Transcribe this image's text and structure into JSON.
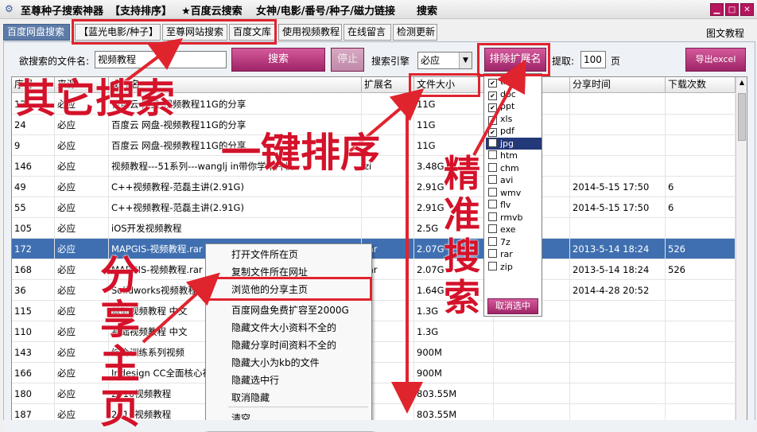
{
  "window": {
    "title_app": "至尊种子搜索神器",
    "title_menu": [
      "【支持排序】",
      "★百度云搜索",
      "女神/电影/番号/种子/磁力链接",
      "搜索"
    ]
  },
  "tabs": [
    "百度网盘搜索",
    "【蓝光电影/种子】",
    "至尊网站搜索",
    "百度文库",
    "使用视频教程",
    "在线留言",
    "检测更新"
  ],
  "help_link": "图文教程",
  "search": {
    "filename_label": "欲搜索的文件名:",
    "filename_value": "视频教程",
    "search_button": "搜索",
    "stop_button": "停止",
    "engine_label": "搜索引擎",
    "engine_value": "必应",
    "exclude_button": "排除扩展名",
    "fetch_label": "提取:",
    "fetch_value": "100",
    "page_unit": "页",
    "export_button": "导出excel"
  },
  "table": {
    "columns": [
      "序号",
      "来源",
      "文件名",
      "扩展名",
      "文件大小",
      "分享时间",
      "下载次数"
    ],
    "rows": [
      {
        "id": "17",
        "src": "必应",
        "name": "百度云 网盘-视频教程11G的分享",
        "ext": "",
        "size": "11G",
        "time": "",
        "dl": ""
      },
      {
        "id": "24",
        "src": "必应",
        "name": "百度云 网盘-视频教程11G的分享",
        "ext": "",
        "size": "11G",
        "time": "",
        "dl": ""
      },
      {
        "id": "9",
        "src": "必应",
        "name": "百度云 网盘-视频教程11G的分享",
        "ext": "",
        "size": "11G",
        "time": "",
        "dl": ""
      },
      {
        "id": "146",
        "src": "必应",
        "name": "视频教程---51系列---wanglj in带你学单片机",
        "ext": "zi",
        "size": "3.48G",
        "time": "",
        "dl": ""
      },
      {
        "id": "49",
        "src": "必应",
        "name": "C++视频教程-范磊主讲(2.91G)",
        "ext": "",
        "size": "2.91G",
        "time": "2014-5-15 17:50",
        "dl": "6"
      },
      {
        "id": "55",
        "src": "必应",
        "name": "C++视频教程-范磊主讲(2.91G)",
        "ext": "",
        "size": "2.91G",
        "time": "2014-5-15 17:50",
        "dl": "6"
      },
      {
        "id": "105",
        "src": "必应",
        "name": "iOS开发视频教程",
        "ext": "",
        "size": "2.5G",
        "time": "",
        "dl": ""
      },
      {
        "id": "172",
        "src": "必应",
        "name": "MAPGIS-视频教程.rar",
        "ext": "rar",
        "size": "2.07G",
        "time": "2013-5-14 18:24",
        "dl": "526"
      },
      {
        "id": "168",
        "src": "必应",
        "name": "MAPGIS-视频教程.rar",
        "ext": "rar",
        "size": "2.07G",
        "time": "2013-5-14 18:24",
        "dl": "526"
      },
      {
        "id": "36",
        "src": "必应",
        "name": "Solidworks视频教程",
        "ext": "",
        "size": "1.64G",
        "time": "2014-4-28 20:52",
        "dl": ""
      },
      {
        "id": "115",
        "src": "必应",
        "name": "基础视频教程 中文",
        "ext": "",
        "size": "1.3G",
        "time": "",
        "dl": ""
      },
      {
        "id": "110",
        "src": "必应",
        "name": "基础视频教程 中文",
        "ext": "",
        "size": "1.3G",
        "time": "",
        "dl": ""
      },
      {
        "id": "143",
        "src": "必应",
        "name": "综合训练系列视频",
        "ext": "",
        "size": "900M",
        "time": "",
        "dl": ""
      },
      {
        "id": "166",
        "src": "必应",
        "name": "Indesign CC全面核心视",
        "ext": "",
        "size": "900M",
        "time": "",
        "dl": ""
      },
      {
        "id": "180",
        "src": "必应",
        "name": "2010视频教程",
        "ext": "",
        "size": "803.55M",
        "time": "",
        "dl": ""
      },
      {
        "id": "187",
        "src": "必应",
        "name": "2010视频教程",
        "ext": "",
        "size": "803.55M",
        "time": "",
        "dl": ""
      }
    ]
  },
  "context_menu": [
    "打开文件所在页",
    "复制文件所在网址",
    "浏览他的分享主页",
    "百度网盘免费扩容至2000G",
    "隐藏文件大小资料不全的",
    "隐藏分享时间资料不全的",
    "隐藏大小为kb的文件",
    "隐藏选中行",
    "取消隐藏",
    "清空"
  ],
  "ext_filter": {
    "items": [
      {
        "name": "txt",
        "checked": true
      },
      {
        "name": "doc",
        "checked": true
      },
      {
        "name": "ppt",
        "checked": true
      },
      {
        "name": "xls",
        "checked": true
      },
      {
        "name": "pdf",
        "checked": true
      },
      {
        "name": "jpg",
        "checked": false
      },
      {
        "name": "htm",
        "checked": false
      },
      {
        "name": "chm",
        "checked": false
      },
      {
        "name": "avi",
        "checked": false
      },
      {
        "name": "wmv",
        "checked": false
      },
      {
        "name": "flv",
        "checked": false
      },
      {
        "name": "rmvb",
        "checked": false
      },
      {
        "name": "exe",
        "checked": false
      },
      {
        "name": "7z",
        "checked": false
      },
      {
        "name": "rar",
        "checked": false
      },
      {
        "name": "zip",
        "checked": false
      }
    ],
    "cancel_button": "取消选中"
  },
  "annotations": {
    "other_search": "其它搜索",
    "one_click_sort": "一键排序",
    "precise_search": "精准搜索",
    "share_home": "分享主页"
  },
  "colors": {
    "accent": "#b8155f",
    "selected_row": "#3f6fb0",
    "annotation": "#e0242e"
  }
}
